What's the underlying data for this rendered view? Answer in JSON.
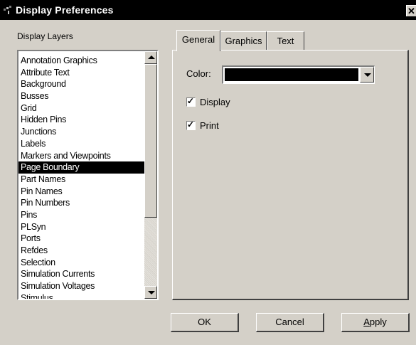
{
  "window": {
    "title": "Display Preferences",
    "icon": "window-icon",
    "close_label": "✕"
  },
  "layers": {
    "label": "Display Layers",
    "selected": "Page Boundary",
    "items": [
      "Annotation Graphics",
      "Attribute Text",
      "Background",
      "Busses",
      "Grid",
      "Hidden Pins",
      "Junctions",
      "Labels",
      "Markers and Viewpoints",
      "Page Boundary",
      "Part Names",
      "Pin Names",
      "Pin Numbers",
      "Pins",
      "PLSyn",
      "Ports",
      "Refdes",
      "Selection",
      "Simulation Currents",
      "Simulation Voltages",
      "Stimulus"
    ]
  },
  "tabs": [
    {
      "label": "General",
      "active": true
    },
    {
      "label": "Graphics",
      "active": false
    },
    {
      "label": "Text",
      "active": false
    }
  ],
  "general": {
    "color_label": "Color:",
    "color_value": "#000000",
    "display_label": "Display",
    "display_checked": true,
    "print_label": "Print",
    "print_checked": true
  },
  "buttons": {
    "ok": "OK",
    "cancel": "Cancel",
    "apply_prefix": "",
    "apply_hotkey": "A",
    "apply_rest": "pply"
  },
  "colors": {
    "face": "#d4d0c8",
    "titlebar": "#000000",
    "selection": "#000000"
  }
}
